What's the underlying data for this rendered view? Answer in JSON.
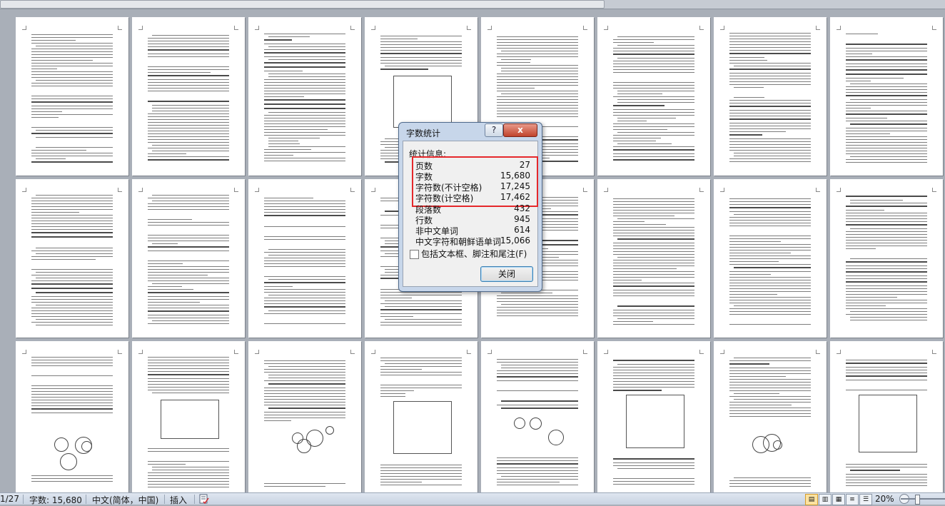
{
  "dialog": {
    "title": "字数统计",
    "help_label": "?",
    "close_x_label": "x",
    "section_label": "统计信息:",
    "stats": [
      {
        "label": "页数",
        "value": "27"
      },
      {
        "label": "字数",
        "value": "15,680"
      },
      {
        "label": "字符数(不计空格)",
        "value": "17,245"
      },
      {
        "label": "字符数(计空格)",
        "value": "17,462"
      },
      {
        "label": "段落数",
        "value": "432"
      },
      {
        "label": "行数",
        "value": "945"
      },
      {
        "label": "非中文单词",
        "value": "614"
      },
      {
        "label": "中文字符和朝鲜语单词",
        "value": "15,066"
      }
    ],
    "include_checkbox_label": "包括文本框、脚注和尾注(F)",
    "include_checked": false,
    "close_button_label": "关闭",
    "highlight_color": "#e5282b"
  },
  "statusbar": {
    "page": "1/27",
    "word_count": "字数: 15,680",
    "language": "中文(简体，中国)",
    "mode": "插入",
    "zoom": "20%",
    "zoom_out": "-",
    "zoom_in": "+"
  },
  "icons": [
    "help-icon",
    "close-icon",
    "checkbox-icon",
    "spellcheck-icon",
    "print-layout-view-icon",
    "full-screen-reading-icon",
    "web-layout-icon",
    "outline-view-icon",
    "draft-view-icon",
    "zoom-out-icon",
    "zoom-in-icon"
  ]
}
